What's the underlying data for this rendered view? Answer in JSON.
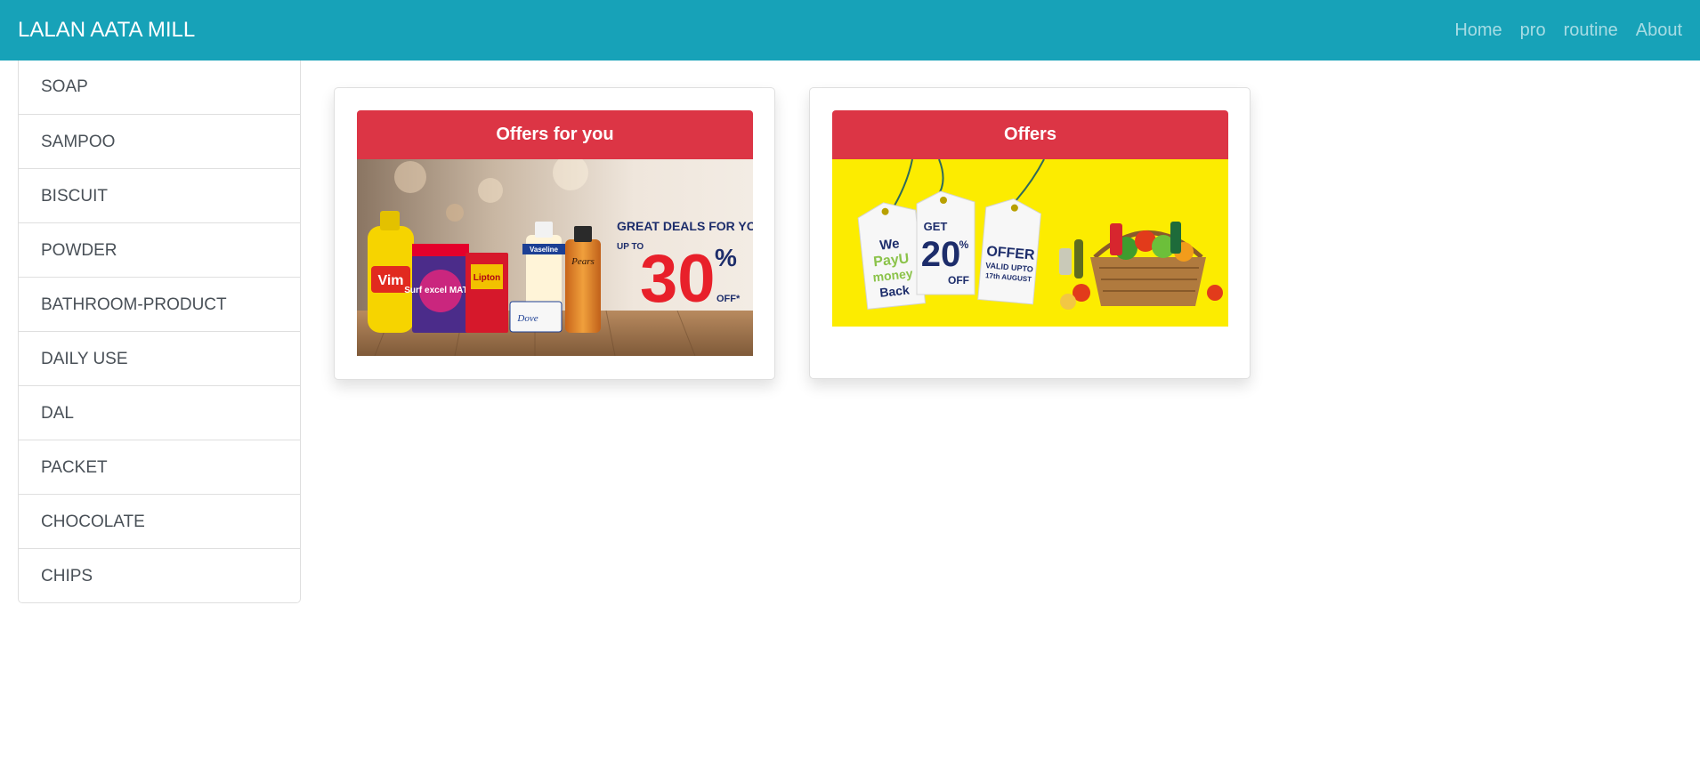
{
  "navbar": {
    "brand": "LALAN AATA MILL",
    "links": [
      "Home",
      "pro",
      "routine",
      "About"
    ]
  },
  "sidebar": {
    "items": [
      "SOAP",
      "SAMPOO",
      "BISCUIT",
      "POWDER",
      "BATHROOM-PRODUCT",
      "DAILY USE",
      "DAL",
      "PACKET",
      "CHOCOLATE",
      "CHIPS"
    ]
  },
  "cards": [
    {
      "header": "Offers for you",
      "banner": {
        "headline": "GREAT DEALS FOR YOU",
        "upto": "UP TO",
        "percent": "30",
        "percent_sign": "%",
        "off": "OFF*",
        "brands": [
          "Vim",
          "Surf excel MATIC",
          "Lipton",
          "Vaseline",
          "Dove",
          "Pears"
        ]
      }
    },
    {
      "header": "Offers",
      "banner": {
        "tag1": [
          "We",
          "PayU",
          "money",
          "Back"
        ],
        "tag2": [
          "GET",
          "20",
          "%",
          "OFF"
        ],
        "tag3": [
          "OFFER",
          "VALID UPTO",
          "17th AUGUST"
        ]
      }
    }
  ],
  "colors": {
    "navbar_bg": "#17a2b8",
    "card_header_bg": "#dc3545",
    "offer_banner_bg": "#fcec00",
    "accent_red": "#e8202a",
    "navy_text": "#1d2d6b"
  }
}
